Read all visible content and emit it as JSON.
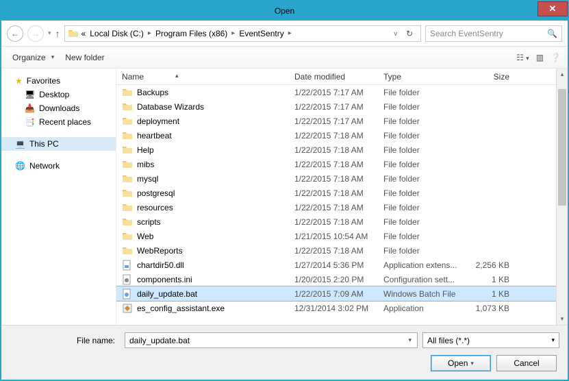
{
  "title": "Open",
  "breadcrumb": {
    "prefix": "«",
    "items": [
      "Local Disk (C:)",
      "Program Files (x86)",
      "EventSentry"
    ]
  },
  "search": {
    "placeholder": "Search EventSentry"
  },
  "toolbar": {
    "organize": "Organize",
    "newfolder": "New folder"
  },
  "sidebar": {
    "favorites": "Favorites",
    "desktop": "Desktop",
    "downloads": "Downloads",
    "recent": "Recent places",
    "thispc": "This PC",
    "network": "Network"
  },
  "columns": {
    "name": "Name",
    "date": "Date modified",
    "type": "Type",
    "size": "Size"
  },
  "files": [
    {
      "icon": "folder",
      "name": "Backups",
      "date": "1/22/2015 7:17 AM",
      "type": "File folder",
      "size": ""
    },
    {
      "icon": "folder",
      "name": "Database Wizards",
      "date": "1/22/2015 7:17 AM",
      "type": "File folder",
      "size": ""
    },
    {
      "icon": "folder",
      "name": "deployment",
      "date": "1/22/2015 7:17 AM",
      "type": "File folder",
      "size": ""
    },
    {
      "icon": "folder",
      "name": "heartbeat",
      "date": "1/22/2015 7:18 AM",
      "type": "File folder",
      "size": ""
    },
    {
      "icon": "folder",
      "name": "Help",
      "date": "1/22/2015 7:18 AM",
      "type": "File folder",
      "size": ""
    },
    {
      "icon": "folder",
      "name": "mibs",
      "date": "1/22/2015 7:18 AM",
      "type": "File folder",
      "size": ""
    },
    {
      "icon": "folder",
      "name": "mysql",
      "date": "1/22/2015 7:18 AM",
      "type": "File folder",
      "size": ""
    },
    {
      "icon": "folder",
      "name": "postgresql",
      "date": "1/22/2015 7:18 AM",
      "type": "File folder",
      "size": ""
    },
    {
      "icon": "folder",
      "name": "resources",
      "date": "1/22/2015 7:18 AM",
      "type": "File folder",
      "size": ""
    },
    {
      "icon": "folder",
      "name": "scripts",
      "date": "1/22/2015 7:18 AM",
      "type": "File folder",
      "size": ""
    },
    {
      "icon": "folder",
      "name": "Web",
      "date": "1/21/2015 10:54 AM",
      "type": "File folder",
      "size": ""
    },
    {
      "icon": "folder",
      "name": "WebReports",
      "date": "1/22/2015 7:18 AM",
      "type": "File folder",
      "size": ""
    },
    {
      "icon": "dll",
      "name": "chartdir50.dll",
      "date": "1/27/2014 5:36 PM",
      "type": "Application extens...",
      "size": "2,256 KB"
    },
    {
      "icon": "ini",
      "name": "components.ini",
      "date": "1/20/2015 2:20 PM",
      "type": "Configuration sett...",
      "size": "1 KB"
    },
    {
      "icon": "bat",
      "name": "daily_update.bat",
      "date": "1/22/2015 7:09 AM",
      "type": "Windows Batch File",
      "size": "1 KB",
      "selected": true
    },
    {
      "icon": "exe",
      "name": "es_config_assistant.exe",
      "date": "12/31/2014 3:02 PM",
      "type": "Application",
      "size": "1,073 KB"
    }
  ],
  "filename_label": "File name:",
  "filename_value": "daily_update.bat",
  "filter": "All files (*.*)",
  "buttons": {
    "open": "Open",
    "cancel": "Cancel"
  }
}
